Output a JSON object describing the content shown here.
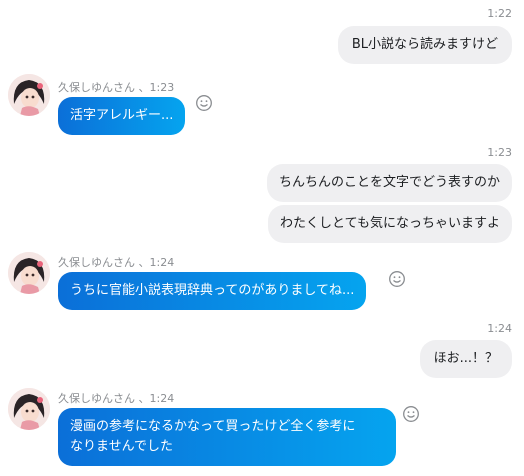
{
  "messages": {
    "m1": {
      "time": "1:22",
      "text": "BL小説なら読みますけど"
    },
    "m2": {
      "sender": "久保しゆんさん 、1:23",
      "text": "活字アレルギー..."
    },
    "m3": {
      "time": "1:23",
      "line1": "ちんちんのことを文字でどう表すのか",
      "line2": "わたくしとても気になっちゃいますよ"
    },
    "m4": {
      "sender": "久保しゆんさん 、1:24",
      "text": "うちに官能小説表現辞典ってのがありましてね..."
    },
    "m5": {
      "time": "1:24",
      "text": "ほお...！？"
    },
    "m6": {
      "sender": "久保しゆんさん 、1:24",
      "line1": "漫画の参考になるかなって買ったけど全く参考に",
      "line2": "なりませんでした"
    }
  },
  "colors": {
    "incoming_start": "#0b6fd8",
    "incoming_end": "#05a4ef",
    "outgoing_bg": "#efeff1"
  },
  "icons": {
    "avatar": "avatar",
    "reaction": "smiley-icon"
  }
}
